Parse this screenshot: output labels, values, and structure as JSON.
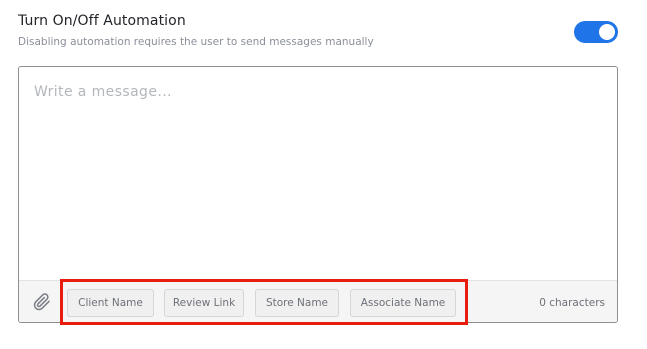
{
  "automation": {
    "title": "Turn On/Off Automation",
    "subtitle": "Disabling automation requires the user to send messages manually",
    "toggle_on": true,
    "toggle_color": "#1f74e8"
  },
  "composer": {
    "placeholder": "Write a message...",
    "value": "",
    "attach_icon": "paperclip-icon",
    "chips": [
      {
        "label": "Client Name"
      },
      {
        "label": "Review Link"
      },
      {
        "label": "Store Name"
      },
      {
        "label": "Associate Name"
      }
    ],
    "char_count": "0 characters"
  },
  "annotation": {
    "highlight_color": "#e81d0e"
  }
}
